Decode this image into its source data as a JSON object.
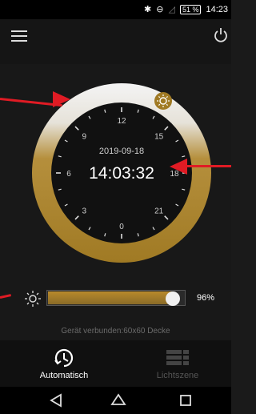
{
  "status_bar": {
    "bluetooth_icon": "bluetooth-icon",
    "dnd_icon": "do-not-disturb-icon",
    "signal_icon": "signal-icon",
    "battery": "51 %",
    "time": "14:23"
  },
  "header": {
    "menu_icon": "hamburger-menu-icon",
    "power_icon": "power-icon"
  },
  "dial": {
    "date": "2019-09-18",
    "time": "14:03:32",
    "hour_labels": [
      "12",
      "15",
      "18",
      "21",
      "0",
      "3",
      "6",
      "9"
    ],
    "sun_marker_icon": "sun-icon"
  },
  "brightness": {
    "icon": "brightness-sun-icon",
    "percent_label": "96%",
    "value": 0.96
  },
  "status_text": "Gerät verbunden:60x60 Decke",
  "tabs": [
    {
      "label": "Automatisch",
      "icon": "clock-auto-icon",
      "active": true
    },
    {
      "label": "Lichtszene",
      "icon": "grid-scene-icon",
      "active": false
    }
  ],
  "colors": {
    "accent": "#b18a2e",
    "ring_light": "#f2f2f2",
    "annotation": "#e01b24"
  }
}
